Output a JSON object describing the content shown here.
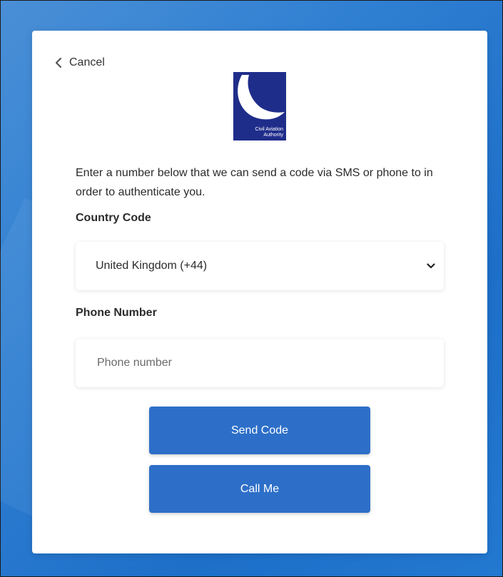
{
  "nav": {
    "cancel_label": "Cancel",
    "cancel_icon": "chevron-left-icon"
  },
  "logo": {
    "text_line1": "Civil Aviation",
    "text_line2": "Authority",
    "color": "#1f2d8a"
  },
  "form": {
    "intro": "Enter a number below that we can send a code via SMS or phone to in order to authenticate you.",
    "country_label": "Country Code",
    "country_selected": "United Kingdom (+44)",
    "country_icon": "chevron-down-icon",
    "phone_label": "Phone Number",
    "phone_value": "",
    "phone_placeholder": "Phone number"
  },
  "buttons": {
    "send_code": "Send Code",
    "call_me": "Call Me",
    "color": "#2d6fc8"
  }
}
